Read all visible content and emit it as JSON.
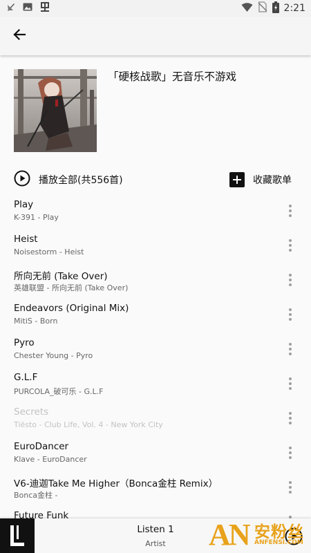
{
  "status_bar": {
    "time": "2:21",
    "left_icons": [
      "notification-muted-icon",
      "image-icon",
      "app-icon"
    ],
    "right_icons": [
      "wifi-icon",
      "no-sim-icon",
      "battery-charging-icon"
    ]
  },
  "toolbar": {
    "back_icon": "arrow-left-icon"
  },
  "playlist": {
    "title": "「硬核战歌」无音乐不游戏"
  },
  "actions": {
    "play_all_label": "播放全部(共556首)",
    "collect_label": "收藏歌单"
  },
  "songs": [
    {
      "title": "Play",
      "subtitle": "K-391 - Play",
      "disabled": false
    },
    {
      "title": "Heist",
      "subtitle": "Noisestorm - Heist",
      "disabled": false
    },
    {
      "title": "所向无前 (Take Over)",
      "subtitle": "英雄联盟 - 所向无前 (Take Over)",
      "disabled": false
    },
    {
      "title": "Endeavors (Original Mix)",
      "subtitle": "MitiS - Born",
      "disabled": false
    },
    {
      "title": "Pyro",
      "subtitle": "Chester Young - Pyro",
      "disabled": false
    },
    {
      "title": "G.L.F",
      "subtitle": "PURCOLA_破可乐 - G.L.F",
      "disabled": false
    },
    {
      "title": "Secrets",
      "subtitle": "Tiësto - Club Life, Vol. 4 - New York City",
      "disabled": true
    },
    {
      "title": "EuroDancer",
      "subtitle": "Klave - EuroDancer",
      "disabled": false
    },
    {
      "title": "V6-迪迦Take Me Higher（Bonca金柱 Remix）",
      "subtitle": "Bonca金柱 -",
      "disabled": false
    },
    {
      "title": "Future Funk",
      "subtitle": "",
      "disabled": false
    }
  ],
  "player": {
    "title": "Listen 1",
    "artist": "Artist",
    "logo_letter": "L"
  },
  "watermark": {
    "brand": "AN",
    "chinese": "安粉丝",
    "url": "ANFENSI.COM"
  },
  "colors": {
    "accent": "#111111",
    "disabled_text": "#c2c2c2",
    "watermark": "#e8a21b"
  }
}
